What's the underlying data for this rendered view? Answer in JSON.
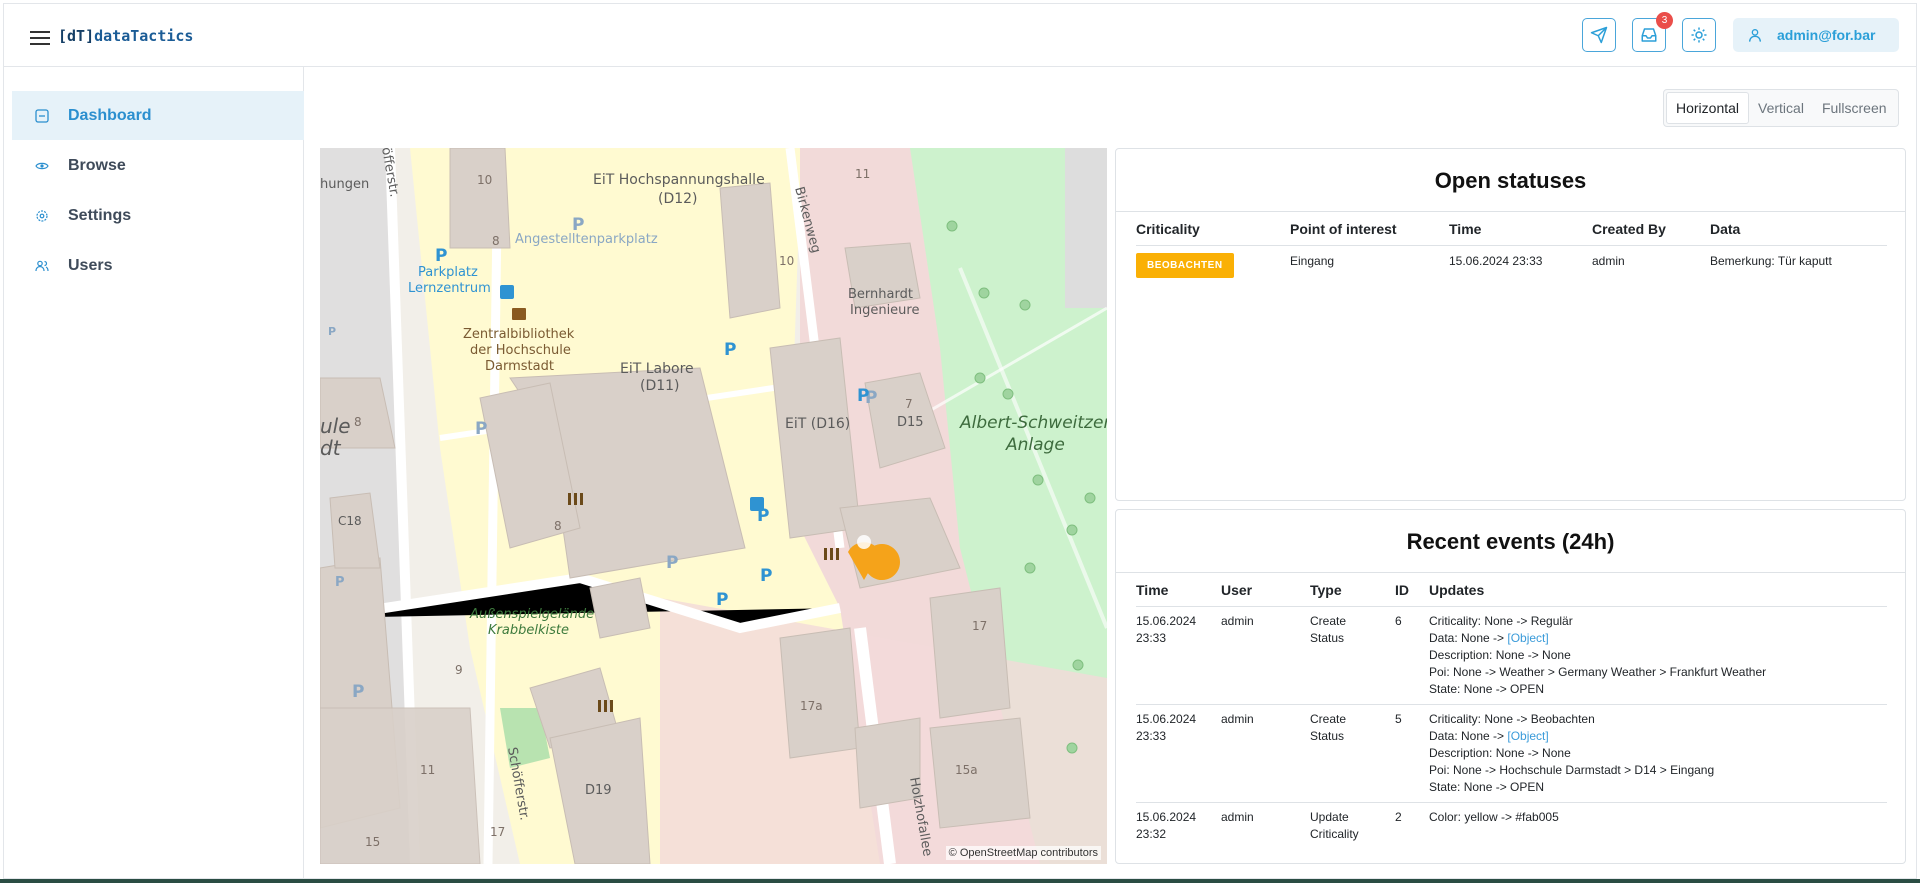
{
  "header": {
    "logo_bracket": "[dT]",
    "logo_text": "dataTactics",
    "notifications_count": "3",
    "user": "admin@for.bar"
  },
  "sidebar": {
    "items": [
      {
        "label": "Dashboard",
        "icon": "dashboard-icon",
        "active": true
      },
      {
        "label": "Browse",
        "icon": "eye-icon",
        "active": false
      },
      {
        "label": "Settings",
        "icon": "gear-icon",
        "active": false
      },
      {
        "label": "Users",
        "icon": "users-icon",
        "active": false
      }
    ]
  },
  "view_toggle": {
    "options": [
      "Horizontal",
      "Vertical",
      "Fullscreen"
    ],
    "selected": "Horizontal"
  },
  "map": {
    "attribution": "© OpenStreetMap contributors",
    "labels": {
      "hall": "EiT Hochspannungshalle",
      "hall_code": "(D12)",
      "angestellten": "Angestelltenparkplatz",
      "parkplatz": "Parkplatz",
      "lernzentrum": "Lernzentrum",
      "bib1": "Zentralbibliothek",
      "bib2": "der Hochschule",
      "bib3": "Darmstadt",
      "labore": "EiT Labore",
      "labore_code": "(D11)",
      "birkenweg": "Birkenweg",
      "bernhardt1": "Bernhardt",
      "bernhardt2": "Ingenieure",
      "eit16": "EiT (D16)",
      "d15": "D15",
      "albert1": "Albert-Schweitzer",
      "albert2": "Anlage",
      "spiel1": "Außenspielgelände",
      "spiel2": "Krabbelkiste",
      "schoffer": "Schöfferstr.",
      "schoffer_top": "öfferstr.",
      "holzhof": "Holzhofallee",
      "d19": "D19",
      "c18": "C18",
      "n10": "10",
      "n8": "8",
      "n11": "11",
      "n7": "7",
      "n17": "17",
      "n17a": "17a",
      "n15a": "15a",
      "n9": "9",
      "n15": "15",
      "n8b": "8",
      "n10b": "10",
      "n8c": "8",
      "n11b": "11",
      "n17b": "17",
      "hungen": "hungen",
      "ule": "ule",
      "dt": "dt"
    },
    "colors": {
      "land": "#f2efe9",
      "residential": "#e0dfdf",
      "building": "#d9d0c9",
      "campus": "#fffad1",
      "pink": "#f2dad9",
      "park": "#cdf2cd",
      "parking_blue": "#2f93d2",
      "pin": "#f5a31a"
    }
  },
  "open_statuses": {
    "title": "Open statuses",
    "columns": [
      "Criticality",
      "Point of interest",
      "Time",
      "Created By",
      "Data"
    ],
    "rows": [
      {
        "criticality": "BEOBACHTEN",
        "poi": "Eingang",
        "time": "15.06.2024 23:33",
        "created_by": "admin",
        "data": "Bemerkung: Tür kaputt"
      }
    ]
  },
  "recent_events": {
    "title": "Recent events (24h)",
    "columns": [
      "Time",
      "User",
      "Type",
      "ID",
      "Updates"
    ],
    "rows": [
      {
        "time1": "15.06.2024",
        "time2": "23:33",
        "user": "admin",
        "type1": "Create",
        "type2": "Status",
        "id": "6",
        "u1": "Criticality: None -> Regulär",
        "u2_prefix": "Data: None -> ",
        "u2_link": "[Object]",
        "u3": "Description: None -> None",
        "u4": "Poi: None -> Weather > Germany Weather > Frankfurt Weather",
        "u5": "State: None -> OPEN"
      },
      {
        "time1": "15.06.2024",
        "time2": "23:33",
        "user": "admin",
        "type1": "Create",
        "type2": "Status",
        "id": "5",
        "u1": "Criticality: None -> Beobachten",
        "u2_prefix": "Data: None -> ",
        "u2_link": "[Object]",
        "u3": "Description: None -> None",
        "u4": "Poi: None -> Hochschule Darmstadt > D14 > Eingang",
        "u5": "State: None -> OPEN"
      },
      {
        "time1": "15.06.2024",
        "time2": "23:32",
        "user": "admin",
        "type1": "Update",
        "type2": "Criticality",
        "id": "2",
        "u1": "Color: yellow -> #fab005"
      }
    ]
  }
}
